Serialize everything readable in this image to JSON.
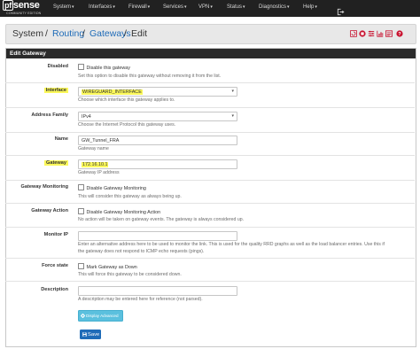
{
  "brand": {
    "name": "sense",
    "prefix": "pf",
    "edition": "COMMUNITY EDITION"
  },
  "nav": {
    "items": [
      {
        "label": "System"
      },
      {
        "label": "Interfaces"
      },
      {
        "label": "Firewall"
      },
      {
        "label": "Services"
      },
      {
        "label": "VPN"
      },
      {
        "label": "Status"
      },
      {
        "label": "Diagnostics"
      },
      {
        "label": "Help"
      }
    ],
    "caret": "▾"
  },
  "breadcrumb": {
    "items": [
      "System",
      "Routing",
      "Gateways",
      "Edit"
    ],
    "separator": "/"
  },
  "panel": {
    "title": "Edit Gateway"
  },
  "form": {
    "disabled": {
      "label": "Disabled",
      "checkbox_label": "Disable this gateway",
      "help": "Set this option to disable this gateway without removing it from the list."
    },
    "interface": {
      "label": "Interface",
      "value": "WIREGUARD_INTERFACE",
      "help": "Choose which interface this gateway applies to."
    },
    "address_family": {
      "label": "Address Family",
      "value": "IPv4",
      "help": "Choose the Internet Protocol this gateway uses."
    },
    "name": {
      "label": "Name",
      "value": "GW_Tunnel_FRA",
      "help": "Gateway name"
    },
    "gateway": {
      "label": "Gateway",
      "value": "172.16.10.1",
      "help": "Gateway IP address"
    },
    "monitoring": {
      "label": "Gateway Monitoring",
      "checkbox_label": "Disable Gateway Monitoring",
      "help": "This will consider this gateway as always being up."
    },
    "action": {
      "label": "Gateway Action",
      "checkbox_label": "Disable Gateway Monitoring Action",
      "help": "No action will be taken on gateway events. The gateway is always considered up."
    },
    "monitor_ip": {
      "label": "Monitor IP",
      "value": "",
      "help_line1": "Enter an alternative address here to be used to monitor the link. This is used for the quality RRD graphs as well as the load balancer entries. Use this if",
      "help_line2": "the gateway does not respond to ICMP echo requests (pings)."
    },
    "force_state": {
      "label": "Force state",
      "checkbox_label": "Mark Gateway as Down",
      "help": "This will force this gateway to be considered down."
    },
    "description": {
      "label": "Description",
      "value": "",
      "help": "A description may be entered here for reference (not parsed)."
    },
    "advanced_button": "Display Advanced",
    "save_button": "Save"
  },
  "colors": {
    "navbar": "#212121",
    "link": "#1e6bb8",
    "highlight": "#fbf85a",
    "info_button": "#5bc0de",
    "primary_button": "#1e6bb8"
  }
}
